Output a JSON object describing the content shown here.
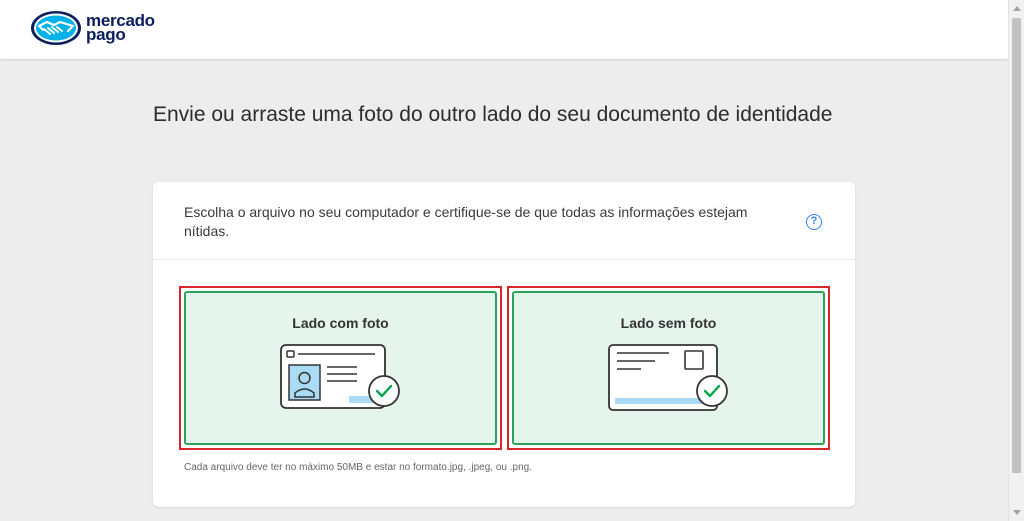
{
  "brand": {
    "name_line1": "mercado",
    "name_line2": "pago"
  },
  "page": {
    "title": "Envie ou arraste uma foto do outro lado do seu documento de identidade",
    "instructions": "Escolha o arquivo no seu computador e certifique-se de que todas as informações estejam nítidas.",
    "help_symbol": "?"
  },
  "options": [
    {
      "label": "Lado com foto",
      "icon": "id-card-with-photo-icon"
    },
    {
      "label": "Lado sem foto",
      "icon": "id-card-without-photo-icon"
    }
  ],
  "footnote": "Cada arquivo deve ter no máximo 50MB e estar no formato.jpg, .jpeg, ou .png.",
  "colors": {
    "brand_navy": "#0a1e5e",
    "brand_blue": "#3483fa",
    "option_fill": "#e5f5ec",
    "option_border": "#2aa35a",
    "selection_outline": "#d8262a"
  }
}
